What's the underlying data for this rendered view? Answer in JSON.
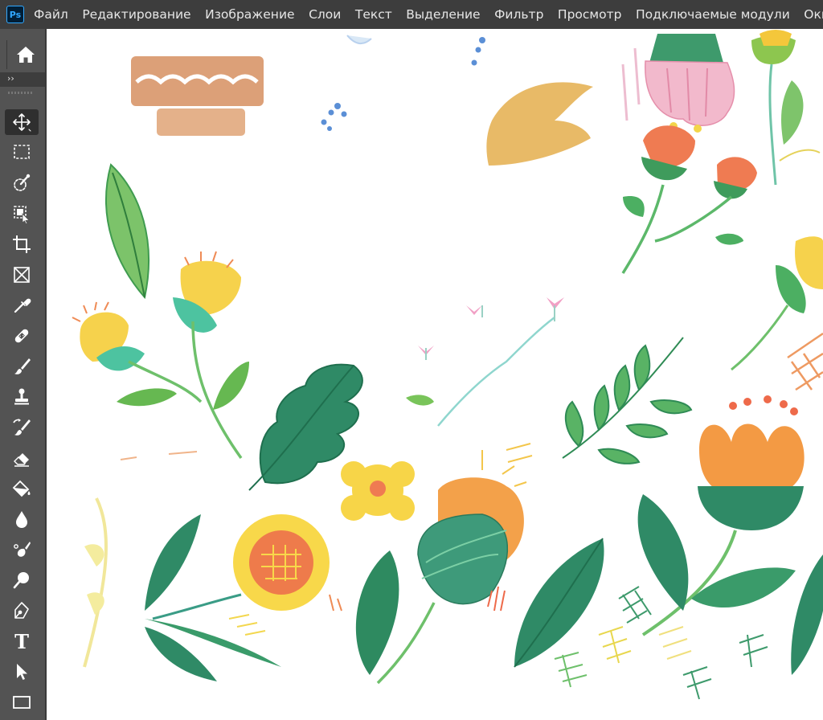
{
  "app": {
    "logo_text": "Ps"
  },
  "menu": [
    "Файл",
    "Редактирование",
    "Изображение",
    "Слои",
    "Текст",
    "Выделение",
    "Фильтр",
    "Просмотр",
    "Подключаемые модули",
    "Окно"
  ],
  "toolbar": {
    "collapse_glyph": "››",
    "tools": [
      {
        "name": "move-tool",
        "icon": "move-icon",
        "active": true
      },
      {
        "name": "rect-marquee-tool",
        "icon": "marquee-icon"
      },
      {
        "name": "quick-selection-tool",
        "icon": "quick-selection-icon"
      },
      {
        "name": "object-selection-tool",
        "icon": "object-selection-icon"
      },
      {
        "name": "crop-tool",
        "icon": "crop-icon"
      },
      {
        "name": "frame-tool",
        "icon": "frame-icon"
      },
      {
        "name": "eyedropper-tool",
        "icon": "eyedropper-icon"
      },
      {
        "name": "healing-brush-tool",
        "icon": "bandage-icon"
      },
      {
        "name": "brush-tool",
        "icon": "brush-icon"
      },
      {
        "name": "clone-stamp-tool",
        "icon": "stamp-icon"
      },
      {
        "name": "history-brush-tool",
        "icon": "history-brush-icon"
      },
      {
        "name": "eraser-tool",
        "icon": "eraser-icon"
      },
      {
        "name": "paint-bucket-tool",
        "icon": "paint-bucket-icon"
      },
      {
        "name": "blur-tool",
        "icon": "drop-icon"
      },
      {
        "name": "smudge-tool",
        "icon": "smudge-icon"
      },
      {
        "name": "dodge-tool",
        "icon": "dodge-icon"
      },
      {
        "name": "pen-tool",
        "icon": "pen-icon"
      },
      {
        "name": "type-tool",
        "icon": "type-icon",
        "label": "T"
      },
      {
        "name": "path-selection-tool",
        "icon": "arrow-cursor-icon"
      },
      {
        "name": "rectangle-tool",
        "icon": "rectangle-icon"
      }
    ]
  },
  "colors": {
    "menubar_bg": "#3d3d3d",
    "panel_bg": "#535353",
    "active_tool_bg": "#2f2f2f",
    "canvas_bg": "#ffffff",
    "accent_ps": "#31a8ff"
  }
}
